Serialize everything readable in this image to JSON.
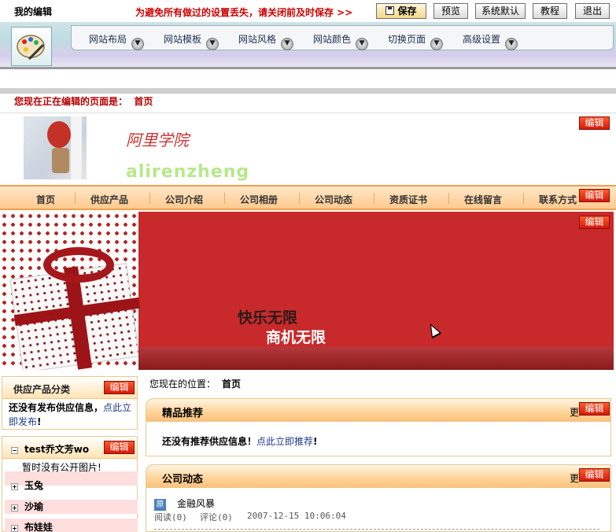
{
  "editor": {
    "my_edit": "我的编辑",
    "warning": "为避免所有做过的设置丢失，请关闭前及时保存 >>",
    "buttons": {
      "save": "保存",
      "preview": "预览",
      "default": "系统默认",
      "tutorial": "教程",
      "exit": "退出"
    },
    "menu": [
      "网站布局",
      "网站模板",
      "网站风格",
      "网站颜色",
      "切换页面",
      "高级设置"
    ],
    "editing_label": "您现在正在编辑的页面是：",
    "editing_page": "首页"
  },
  "site": {
    "title": "阿里学院",
    "subtitle": "alirenzheng",
    "nav": [
      "首页",
      "供应产品",
      "公司介绍",
      "公司相册",
      "公司动态",
      "资质证书",
      "在线留言",
      "联系方式"
    ],
    "banner": {
      "line1": "快乐无限",
      "line2": "商机无限"
    },
    "edit_label": "编辑"
  },
  "left": {
    "category_title": "供应产品分类",
    "no_supply_text": "还没有发布供应信息，",
    "no_supply_link": "点此立即发布",
    "no_supply_end": "!",
    "album_title": "test乔文芳wo",
    "no_pics": "暂时没有公开图片!",
    "tree": [
      "玉兔",
      "沙瑜",
      "布娃娃"
    ]
  },
  "main": {
    "breadcrumb_label": "您现在的位置：",
    "breadcrumb_page": "首页",
    "featured_title": "精品推荐",
    "more": "更",
    "no_recommend_text": "还没有推荐供应信息！",
    "no_recommend_link": "点此立即推荐",
    "no_recommend_end": "!",
    "news_title": "公司动态",
    "news_item": {
      "badge": "原",
      "title": "金融风暴",
      "reads": "阅读(0)",
      "comments": "评论(0)",
      "date": "2007-12-15 10:06:04"
    }
  },
  "colors": {
    "accent_red": "#c82a2b",
    "nav_orange": "#ffc98e",
    "edit_button": "#e0301b"
  }
}
